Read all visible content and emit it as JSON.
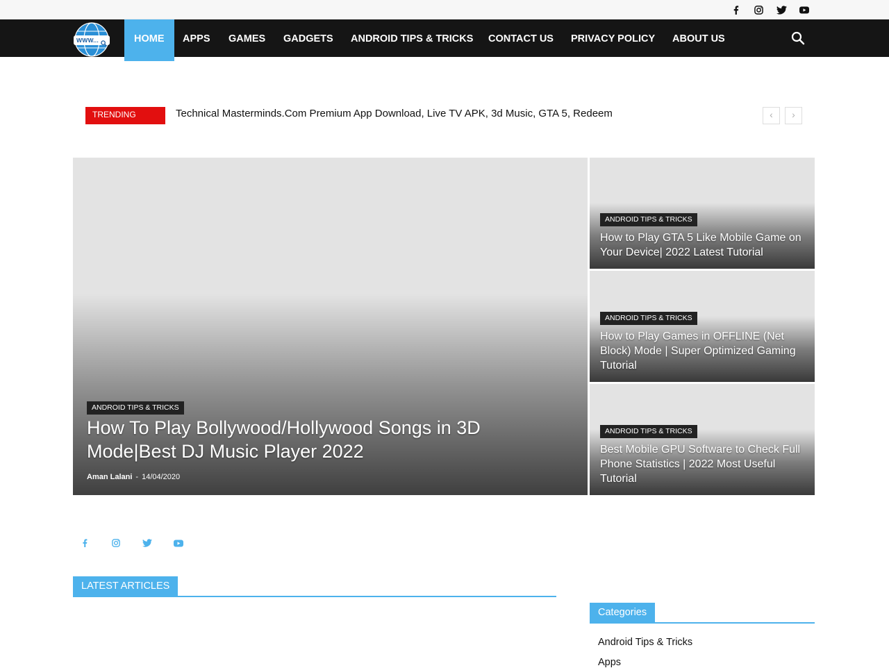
{
  "topbar": {
    "social_icons": [
      "facebook-icon",
      "instagram-icon",
      "twitter-icon",
      "youtube-icon"
    ]
  },
  "logo": {
    "text": "WWW..."
  },
  "nav": {
    "items": [
      {
        "label": "HOME",
        "active": true
      },
      {
        "label": "APPS"
      },
      {
        "label": "GAMES"
      },
      {
        "label": "GADGETS"
      },
      {
        "label": "ANDROID TIPS & TRICKS"
      },
      {
        "label": "CONTACT US"
      },
      {
        "label": "PRIVACY POLICY"
      },
      {
        "label": "ABOUT US"
      }
    ],
    "search_icon": "search-icon"
  },
  "trending": {
    "label": "TRENDING",
    "headline": "Technical Masterminds.Com Premium App Download, Live TV APK, 3d Music, GTA 5, Redeem",
    "prev_label": "‹",
    "next_label": "›"
  },
  "featured": {
    "main": {
      "category": "ANDROID TIPS & TRICKS",
      "title": "How To Play Bollywood/Hollywood Songs in 3D Mode|Best DJ Music Player 2022",
      "author": "Aman Lalani",
      "separator": "-",
      "date": "14/04/2020"
    },
    "side": [
      {
        "category": "ANDROID TIPS & TRICKS",
        "title": "How to Play GTA 5 Like Mobile Game on Your Device| 2022 Latest Tutorial"
      },
      {
        "category": "ANDROID TIPS & TRICKS",
        "title": "How to Play Games in OFFLINE (Net Block) Mode | Super Optimized Gaming Tutorial"
      },
      {
        "category": "ANDROID TIPS & TRICKS",
        "title": "Best Mobile GPU Software to Check Full Phone Statistics | 2022 Most Useful Tutorial"
      }
    ]
  },
  "social_row": [
    "facebook-icon",
    "instagram-icon",
    "twitter-icon",
    "youtube-icon"
  ],
  "latest": {
    "title": "LATEST ARTICLES"
  },
  "sidebar": {
    "categories_title": "Categories",
    "categories": [
      "Android Tips & Tricks",
      "Apps"
    ]
  },
  "colors": {
    "accent": "#4db2ec",
    "trending_red": "#e20f0f",
    "nav_bg": "#151515",
    "badge_bg": "#222222"
  }
}
